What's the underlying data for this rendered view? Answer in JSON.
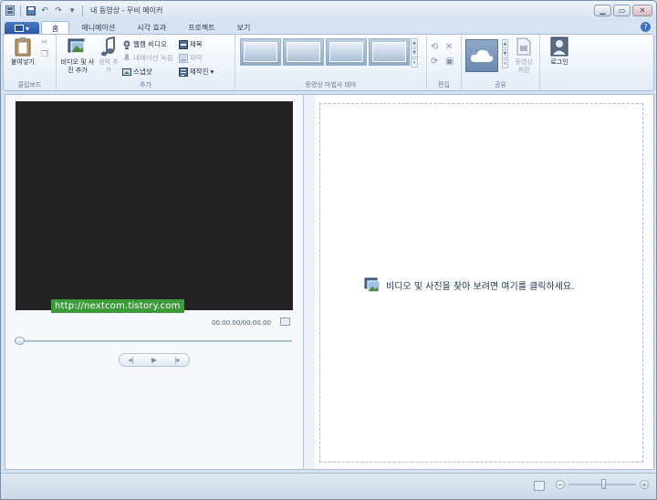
{
  "window": {
    "title": "내 동영상 - 무비 메이커",
    "controls": {
      "minimize": "▁",
      "maximize": "▭",
      "close": "✕"
    }
  },
  "quick_access": {
    "save": "💾",
    "undo": "↶",
    "redo": "↷",
    "dropdown": "▾"
  },
  "app_menu": {
    "label": "▾"
  },
  "tabs": [
    {
      "label": "홈",
      "active": true
    },
    {
      "label": "애니메이션",
      "active": false
    },
    {
      "label": "시각 효과",
      "active": false
    },
    {
      "label": "프로젝트",
      "active": false
    },
    {
      "label": "보기",
      "active": false
    }
  ],
  "help": "?",
  "ribbon": {
    "clipboard": {
      "label": "클립보드",
      "paste": "붙여넣기"
    },
    "add": {
      "label": "추가",
      "add_videos_photos": "비디오 및 사진 추가",
      "add_music": "음악 추가",
      "webcam": "웹캠 비디오",
      "narration": "내레이션 녹음",
      "snapshot": "스냅샷",
      "title": "제목",
      "caption": "자막",
      "credits": "제작진"
    },
    "themes": {
      "label": "동영상 마법사 테마"
    },
    "editing": {
      "label": "편집"
    },
    "share": {
      "label": "공유",
      "save_movie": "동영상 저장"
    },
    "signin": {
      "label": "로그인"
    }
  },
  "preview": {
    "watermark": "http://nextcom.tistory.com",
    "time": "00:00.00/00:00.00",
    "controls": {
      "prev": "◂|",
      "play": "▶",
      "next": "|▸"
    }
  },
  "storyboard": {
    "message": "비디오 및 사진을 찾아 보려면 여기를 클릭하세요."
  },
  "status": {
    "zoom_out": "−",
    "zoom_in": "+"
  },
  "colors": {
    "accent": "#2353a0",
    "watermark": "#3d9a3a"
  }
}
